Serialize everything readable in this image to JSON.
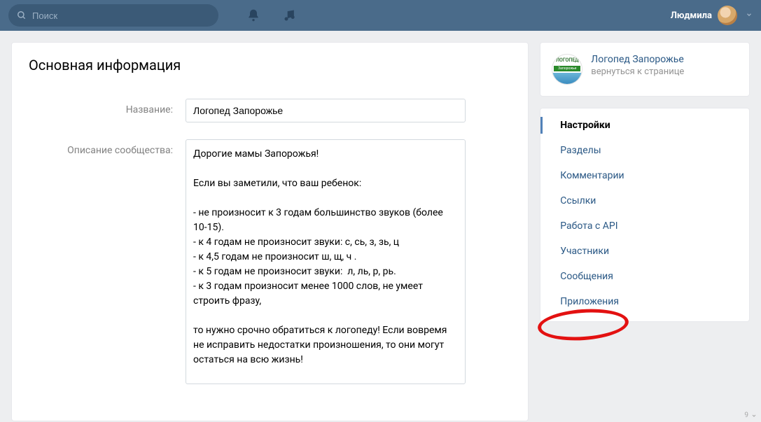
{
  "topbar": {
    "search_placeholder": "Поиск",
    "username": "Людмила"
  },
  "main": {
    "title": "Основная информация",
    "labels": {
      "name": "Название:",
      "description": "Описание сообщества:"
    },
    "fields": {
      "name_value": "Логопед Запорожье",
      "description_value": "Дорогие мамы Запорожья!\n\nЕсли вы заметили, что ваш ребенок:\n\n- не произносит к 3 годам большинство звуков (более 10-15).\n- к 4 годам не произносит звуки: с, сь, з, зь, ц\n- к 4,5 годам не произносит ш, щ, ч .\n- к 5 годам не произносит звуки:  л, ль, р, рь.\n- к 3 годам произносит менее 1000 слов, не умеет строить фразу,\n\nто нужно срочно обратиться к логопеду! Если вовремя не исправить недостатки произношения, то они могут остаться на всю жизнь!"
    }
  },
  "sidebar": {
    "community": {
      "logo_top": "ЛОГОПЕД",
      "logo_banner": "Запорожье",
      "name": "Логопед Запорожье",
      "back_label": "вернуться к странице"
    },
    "menu": [
      {
        "label": "Настройки",
        "active": true
      },
      {
        "label": "Разделы",
        "active": false
      },
      {
        "label": "Комментарии",
        "active": false
      },
      {
        "label": "Ссылки",
        "active": false
      },
      {
        "label": "Работа с API",
        "active": false
      },
      {
        "label": "Участники",
        "active": false
      },
      {
        "label": "Сообщения",
        "active": false
      },
      {
        "label": "Приложения",
        "active": false
      }
    ]
  },
  "scrollhint": "9"
}
